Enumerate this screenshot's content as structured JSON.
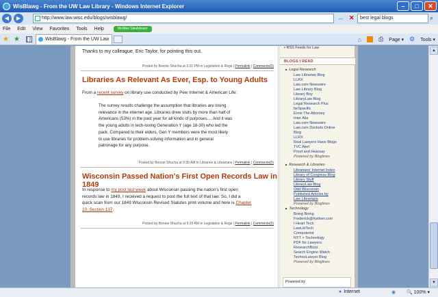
{
  "window": {
    "title": "WisBlawg - From the UW Law Library - Windows Internet Explorer",
    "minimize": "–",
    "maximize": "□",
    "close": "✕"
  },
  "address_bar": {
    "back": "◀",
    "forward": "▶",
    "url": "http://www.law.wisc.edu/blogs/wisblawg/",
    "go": "↔",
    "stop": "✕",
    "search_value": "best legal blogs",
    "search_icon": "⌕"
  },
  "menu": {
    "items": [
      "File",
      "Edit",
      "View",
      "Favorites",
      "Tools",
      "Help"
    ],
    "mcafee": "McAfee SiteAdvisor"
  },
  "tabs": {
    "active_label": "WisBlawg - From the UW Law Library",
    "home_icon": "⌂",
    "rss_icon": "RSS",
    "print_icon": "⎙",
    "page_label": "Page ▾",
    "tools_label": "Tools ▾"
  },
  "content": {
    "thanks": "Thanks to my colleague, Eric Taylor, for pointing this out.",
    "meta1": {
      "prefix": "Posted by Bonnie Shucha at 3:31 PM in Legislation & Regs | ",
      "permalink": "Permalink",
      "comments": "Comments(0)"
    },
    "post2": {
      "title": "Libraries As Relevant As Ever, Esp. to Young Adults",
      "intro_a": "From a ",
      "intro_link": "recent survey",
      "intro_b": " on library use conducted by Pew Internet & American Life:",
      "quote_lines": [
        "The survey results challenge the assumption that libraries are losing",
        "relevance in the internet age. Libraries drew visits by more than half of",
        "Americans (53%) in the past year for all kinds of purposes.... And it was",
        "the young adults in tech-loving Generation Y (age 18-30) who led the",
        "pack. Compared to their elders, Gen Y members were the most likely",
        "to use libraries for problem-solving information and in general",
        "patronage for any purpose."
      ],
      "meta_prefix": "Posted by Bonnie Shucha at 9:30 AM in Libraries & Librarians | ",
      "permalink": "Permalink",
      "comments": "Comments(0)"
    },
    "post3": {
      "title": "Wisconsin Passed Nation's First Open Records Law in 1849",
      "line1_a": "In response to ",
      "line1_link": "my post last week",
      "line1_b": " about Wisconsin passing the nation's first open",
      "line2": "records law in 1849, I received a request to post the full text of that law. So, I did a",
      "line3_a": "quick scan from our 1849 Wisconsin Revised Statutes print volume and here is ",
      "line3_link": "Chapter",
      "line4_link": "10, Section 137",
      "line4_b": ".",
      "meta_prefix": "Posted by Bonnie Shucha at 9:29 AM in Legislation & Regs | ",
      "permalink": "Permalink",
      "comments": "Comments(0)"
    }
  },
  "sidebar": {
    "top_link": "RSS Feeds for Law",
    "heading": "BLOGS I READ",
    "sections": [
      {
        "name": "Legal Research",
        "items": [
          "Law Librarian Blog",
          "LLRX",
          "Law.com Newswire",
          "Law Library Blog",
          "Library Boy",
          "LibraryLaw Blog",
          "Legal Research Plus",
          "beSpacific",
          "Ernie The Attorney",
          "Inter Alia",
          "Law.com Newswire",
          "Law.com Dockets Online",
          "Blog",
          "LLRX",
          "Real Lawyers Have Blogs",
          "TVC Alert",
          "Proof and Hearsay",
          "Powered by Bloglines"
        ]
      },
      {
        "name": "Research & Libraries",
        "items": [
          "Librarians' Internet Index",
          "Library of Congress Blog",
          "Library Stuff",
          "LibraryLaw Blog",
          "Odd Wisconsin",
          "Published Articles by",
          "Law Librarians",
          "Powered by Bloglines"
        ]
      },
      {
        "name": "Technology",
        "items": [
          "Boing Boing",
          "Frederick@Kellner.com",
          "I Heart Tech",
          "LawLibTech",
          "Computerist",
          "NYT > Technology",
          "PDF for Lawyers",
          "ResearchBuzz",
          "Search Engine Watch",
          "TechnoLawyer Blog",
          "Powered by Bloglines"
        ]
      }
    ],
    "powered_by": "Powered by"
  },
  "statusbar": {
    "zone": "Internet",
    "lock_icon": "🔒",
    "zoom": "🔍 100% ▾"
  }
}
